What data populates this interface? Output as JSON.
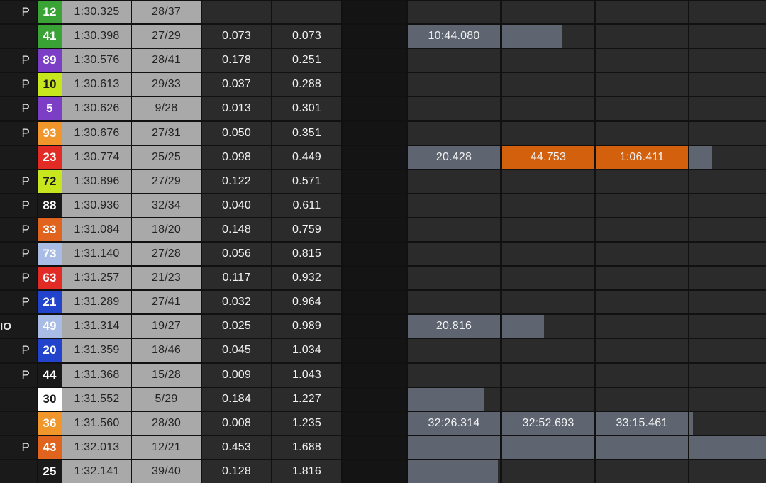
{
  "rows": [
    {
      "flag": "P",
      "num": "12",
      "color": "#3aa336",
      "num_text_color": "#ffffff",
      "lap": "1:30.325",
      "laps": "28/37",
      "gap": "",
      "diff": "",
      "s1": {
        "text": "",
        "fill": 0
      },
      "s2": {
        "text": "",
        "fill": 0
      },
      "s3": {
        "text": "",
        "fill": 0
      },
      "s4": {
        "text": "",
        "fill": 0
      }
    },
    {
      "flag": "",
      "num": "41",
      "color": "#3aa336",
      "num_text_color": "#ffffff",
      "lap": "1:30.398",
      "laps": "27/29",
      "gap": "0.073",
      "diff": "0.073",
      "s1": {
        "text": "10:44.080",
        "fill": 1
      },
      "s2": {
        "text": "",
        "fill": 0.65
      },
      "s3": {
        "text": "",
        "fill": 0
      },
      "s4": {
        "text": "",
        "fill": 0
      }
    },
    {
      "flag": "P",
      "num": "89",
      "color": "#7b3ec4",
      "num_text_color": "#ffffff",
      "lap": "1:30.576",
      "laps": "28/41",
      "gap": "0.178",
      "diff": "0.251",
      "s1": {
        "text": "",
        "fill": 0
      },
      "s2": {
        "text": "",
        "fill": 0
      },
      "s3": {
        "text": "",
        "fill": 0
      },
      "s4": {
        "text": "",
        "fill": 0
      }
    },
    {
      "flag": "P",
      "num": "10",
      "color": "#c8e61e",
      "num_text_color": "#1a1a1a",
      "lap": "1:30.613",
      "laps": "29/33",
      "gap": "0.037",
      "diff": "0.288",
      "s1": {
        "text": "",
        "fill": 0
      },
      "s2": {
        "text": "",
        "fill": 0
      },
      "s3": {
        "text": "",
        "fill": 0
      },
      "s4": {
        "text": "",
        "fill": 0
      }
    },
    {
      "flag": "P",
      "num": "5",
      "color": "#7b3ec4",
      "num_text_color": "#ffffff",
      "lap": "1:30.626",
      "laps": "9/28",
      "gap": "0.013",
      "diff": "0.301",
      "s1": {
        "text": "",
        "fill": 0
      },
      "s2": {
        "text": "",
        "fill": 0
      },
      "s3": {
        "text": "",
        "fill": 0
      },
      "s4": {
        "text": "",
        "fill": 0
      }
    },
    {
      "flag": "P",
      "num": "93",
      "color": "#f0962a",
      "num_text_color": "#ffffff",
      "lap": "1:30.676",
      "laps": "27/31",
      "gap": "0.050",
      "diff": "0.351",
      "s1": {
        "text": "",
        "fill": 0
      },
      "s2": {
        "text": "",
        "fill": 0
      },
      "s3": {
        "text": "",
        "fill": 0
      },
      "s4": {
        "text": "",
        "fill": 0
      }
    },
    {
      "flag": "",
      "num": "23",
      "color": "#e32b26",
      "num_text_color": "#ffffff",
      "lap": "1:30.774",
      "laps": "25/25",
      "gap": "0.098",
      "diff": "0.449",
      "s1": {
        "text": "20.428",
        "fill": 1
      },
      "s2": {
        "text": "44.753",
        "fill": 1,
        "accent": "#d2600c"
      },
      "s3": {
        "text": "1:06.411",
        "fill": 1,
        "accent": "#d2600c"
      },
      "s4": {
        "text": "",
        "fill": 0.3
      }
    },
    {
      "flag": "P",
      "num": "72",
      "color": "#c8e61e",
      "num_text_color": "#1a1a1a",
      "lap": "1:30.896",
      "laps": "27/29",
      "gap": "0.122",
      "diff": "0.571",
      "s1": {
        "text": "",
        "fill": 0
      },
      "s2": {
        "text": "",
        "fill": 0
      },
      "s3": {
        "text": "",
        "fill": 0
      },
      "s4": {
        "text": "",
        "fill": 0
      }
    },
    {
      "flag": "P",
      "num": "88",
      "color": "#1a1a1a",
      "num_text_color": "#ffffff",
      "lap": "1:30.936",
      "laps": "32/34",
      "gap": "0.040",
      "diff": "0.611",
      "s1": {
        "text": "",
        "fill": 0
      },
      "s2": {
        "text": "",
        "fill": 0
      },
      "s3": {
        "text": "",
        "fill": 0
      },
      "s4": {
        "text": "",
        "fill": 0
      }
    },
    {
      "flag": "P",
      "num": "33",
      "color": "#e0641e",
      "num_text_color": "#ffffff",
      "lap": "1:31.084",
      "laps": "18/20",
      "gap": "0.148",
      "diff": "0.759",
      "s1": {
        "text": "",
        "fill": 0
      },
      "s2": {
        "text": "",
        "fill": 0
      },
      "s3": {
        "text": "",
        "fill": 0
      },
      "s4": {
        "text": "",
        "fill": 0
      }
    },
    {
      "flag": "P",
      "num": "73",
      "color": "#a8bce6",
      "num_text_color": "#ffffff",
      "lap": "1:31.140",
      "laps": "27/28",
      "gap": "0.056",
      "diff": "0.815",
      "s1": {
        "text": "",
        "fill": 0
      },
      "s2": {
        "text": "",
        "fill": 0
      },
      "s3": {
        "text": "",
        "fill": 0
      },
      "s4": {
        "text": "",
        "fill": 0
      }
    },
    {
      "flag": "P",
      "num": "63",
      "color": "#e32b26",
      "num_text_color": "#ffffff",
      "lap": "1:31.257",
      "laps": "21/23",
      "gap": "0.117",
      "diff": "0.932",
      "s1": {
        "text": "",
        "fill": 0
      },
      "s2": {
        "text": "",
        "fill": 0
      },
      "s3": {
        "text": "",
        "fill": 0
      },
      "s4": {
        "text": "",
        "fill": 0
      }
    },
    {
      "flag": "P",
      "num": "21",
      "color": "#2244cc",
      "num_text_color": "#ffffff",
      "lap": "1:31.289",
      "laps": "27/41",
      "gap": "0.032",
      "diff": "0.964",
      "s1": {
        "text": "",
        "fill": 0
      },
      "s2": {
        "text": "",
        "fill": 0
      },
      "s3": {
        "text": "",
        "fill": 0
      },
      "s4": {
        "text": "",
        "fill": 0
      }
    },
    {
      "flag": "IO",
      "num": "49",
      "color": "#a8bce6",
      "num_text_color": "#ffffff",
      "lap": "1:31.314",
      "laps": "19/27",
      "gap": "0.025",
      "diff": "0.989",
      "s1": {
        "text": "20.816",
        "fill": 1
      },
      "s2": {
        "text": "",
        "fill": 0.45
      },
      "s3": {
        "text": "",
        "fill": 0
      },
      "s4": {
        "text": "",
        "fill": 0
      }
    },
    {
      "flag": "P",
      "num": "20",
      "color": "#2244cc",
      "num_text_color": "#ffffff",
      "lap": "1:31.359",
      "laps": "18/46",
      "gap": "0.045",
      "diff": "1.034",
      "s1": {
        "text": "",
        "fill": 0
      },
      "s2": {
        "text": "",
        "fill": 0
      },
      "s3": {
        "text": "",
        "fill": 0
      },
      "s4": {
        "text": "",
        "fill": 0
      }
    },
    {
      "flag": "P",
      "num": "44",
      "color": "#1a1a1a",
      "num_text_color": "#ffffff",
      "lap": "1:31.368",
      "laps": "15/28",
      "gap": "0.009",
      "diff": "1.043",
      "s1": {
        "text": "",
        "fill": 0
      },
      "s2": {
        "text": "",
        "fill": 0
      },
      "s3": {
        "text": "",
        "fill": 0
      },
      "s4": {
        "text": "",
        "fill": 0
      }
    },
    {
      "flag": "",
      "num": "30",
      "color": "#ffffff",
      "num_text_color": "#1a1a1a",
      "lap": "1:31.552",
      "laps": "5/29",
      "gap": "0.184",
      "diff": "1.227",
      "s1": {
        "text": "",
        "fill": 0.82
      },
      "s2": {
        "text": "",
        "fill": 0
      },
      "s3": {
        "text": "",
        "fill": 0
      },
      "s4": {
        "text": "",
        "fill": 0
      }
    },
    {
      "flag": "",
      "num": "36",
      "color": "#f0962a",
      "num_text_color": "#ffffff",
      "lap": "1:31.560",
      "laps": "28/30",
      "gap": "0.008",
      "diff": "1.235",
      "s1": {
        "text": "32:26.314",
        "fill": 1
      },
      "s2": {
        "text": "32:52.693",
        "fill": 1
      },
      "s3": {
        "text": "33:15.461",
        "fill": 1
      },
      "s4": {
        "text": "",
        "fill": 0.05
      }
    },
    {
      "flag": "P",
      "num": "43",
      "color": "#e0641e",
      "num_text_color": "#ffffff",
      "lap": "1:32.013",
      "laps": "12/21",
      "gap": "0.453",
      "diff": "1.688",
      "s1": {
        "text": "",
        "fill": 1
      },
      "s2": {
        "text": "",
        "fill": 1
      },
      "s3": {
        "text": "",
        "fill": 1
      },
      "s4": {
        "text": "",
        "fill": 1
      }
    },
    {
      "flag": "",
      "num": "25",
      "color": "#1a1a1a",
      "num_text_color": "#ffffff",
      "lap": "1:32.141",
      "laps": "39/40",
      "gap": "0.128",
      "diff": "1.816",
      "s1": {
        "text": "",
        "fill": 0.98
      },
      "s2": {
        "text": "",
        "fill": 0
      },
      "s3": {
        "text": "",
        "fill": 0
      },
      "s4": {
        "text": "",
        "fill": 0
      }
    }
  ]
}
